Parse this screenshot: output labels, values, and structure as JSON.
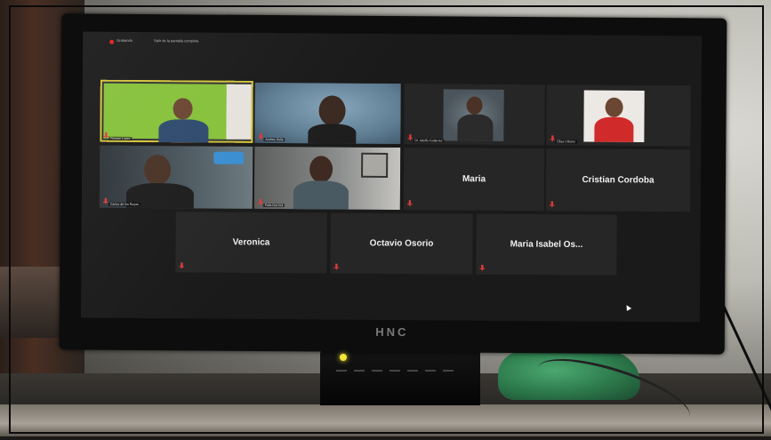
{
  "topbar": {
    "rec_label": "Grabando",
    "view_label": "Salir de la pantalla completa"
  },
  "monitor": {
    "brand": "HNC"
  },
  "tiles": [
    {
      "name": "Roman Lopez",
      "type": "video",
      "bg": "#8bc63a"
    },
    {
      "name": "Andres Solis",
      "type": "video",
      "bg": "#6a8aa3"
    },
    {
      "name": "Dr. Adolfo Gutierrez",
      "type": "video",
      "bg": "#5a6670"
    },
    {
      "name": "Elias Urbano",
      "type": "video",
      "bg": "#e8e4e0"
    },
    {
      "name": "Carlos de los Reyes",
      "type": "video",
      "bg": "#3b4a52"
    },
    {
      "name": "Felix Del Cid",
      "type": "video",
      "bg": "#7b7d7c"
    },
    {
      "name": "Maria",
      "type": "name"
    },
    {
      "name": "Cristian Cordoba",
      "type": "name"
    },
    {
      "name": "Veronica",
      "type": "name"
    },
    {
      "name": "Octavio Osorio",
      "type": "name"
    },
    {
      "name": "Maria Isabel Os...",
      "type": "name"
    }
  ]
}
